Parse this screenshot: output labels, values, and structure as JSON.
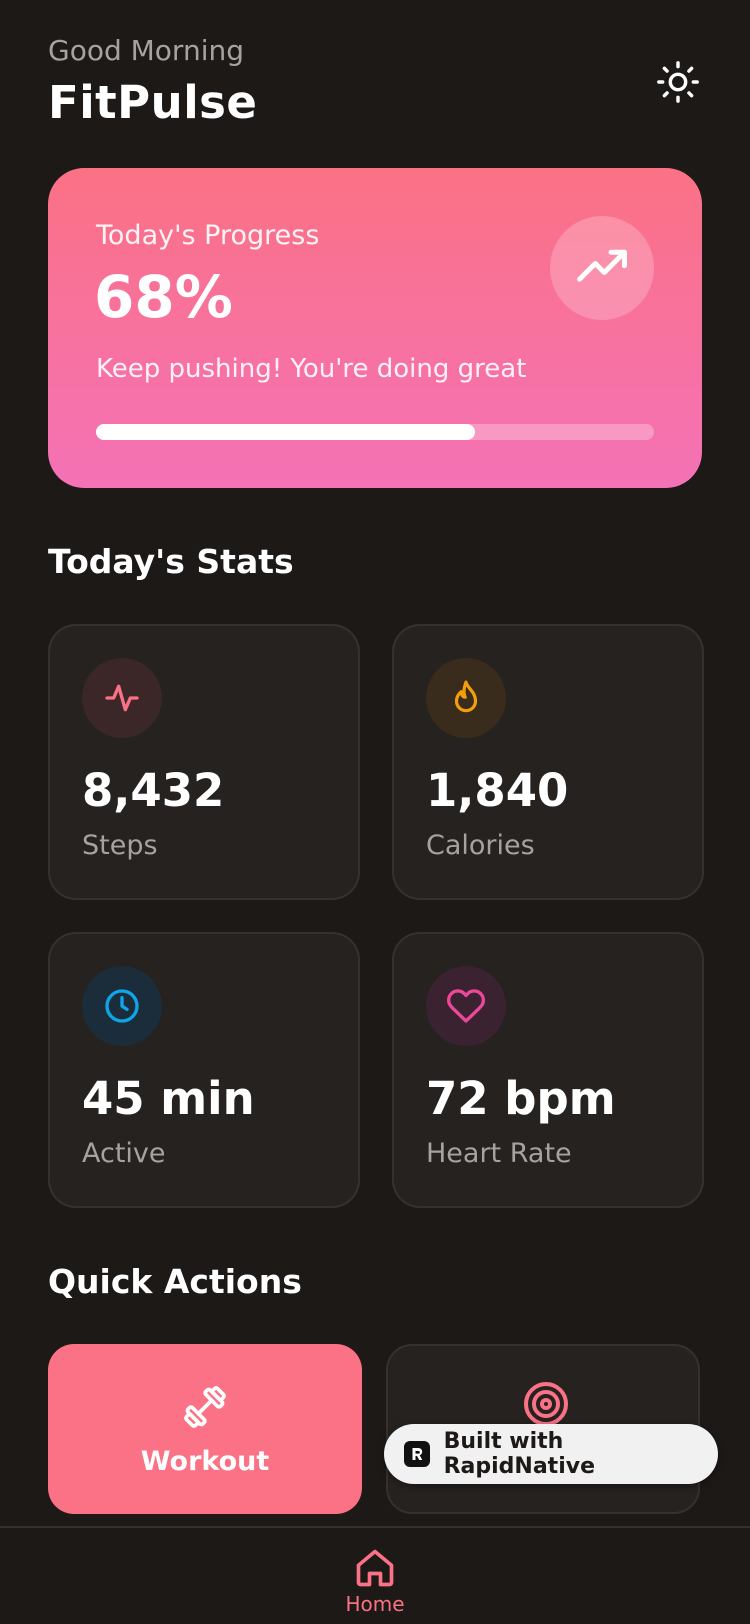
{
  "header": {
    "greeting": "Good Morning",
    "title": "FitPulse",
    "theme_icon": "sun-icon"
  },
  "progress": {
    "label": "Today's Progress",
    "value": "68%",
    "fraction": 0.68,
    "subtitle": "Keep pushing! You're doing great",
    "icon": "trending-up-icon"
  },
  "stats": {
    "title": "Today's Stats",
    "items": [
      {
        "value": "8,432",
        "label": "Steps",
        "icon": "activity-icon",
        "color": "#fb7185"
      },
      {
        "value": "1,840",
        "label": "Calories",
        "icon": "flame-icon",
        "color": "#f59e0b"
      },
      {
        "value": "45 min",
        "label": "Active",
        "icon": "clock-icon",
        "color": "#0ea5e9"
      },
      {
        "value": "72 bpm",
        "label": "Heart Rate",
        "icon": "heart-icon",
        "color": "#ec4899"
      }
    ]
  },
  "quick_actions": {
    "title": "Quick Actions",
    "items": [
      {
        "label": "Workout",
        "icon": "dumbbell-icon"
      },
      {
        "icon": "target-icon"
      }
    ]
  },
  "badge": {
    "text": "Built with RapidNative"
  },
  "tabbar": {
    "home_label": "Home",
    "home_icon": "home-icon"
  },
  "colors": {
    "accent": "#fb7185",
    "background": "#1c1917",
    "card": "#262220"
  }
}
